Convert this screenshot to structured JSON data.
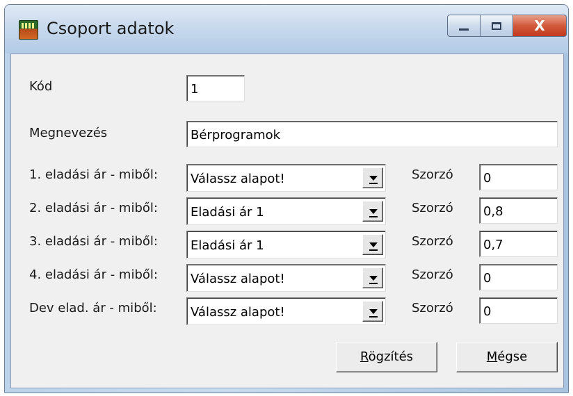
{
  "window": {
    "title": "Csoport adatok",
    "icon": "app-icon",
    "controls": {
      "minimize": "minimize",
      "maximize": "maximize",
      "close": "X"
    }
  },
  "form": {
    "code_label": "Kód",
    "code_value": "1",
    "name_label": "Megnevezés",
    "name_value": "Bérprogramok",
    "multiplier_label": "Szorzó",
    "rows": [
      {
        "label": "1. eladási ár - miből:",
        "source": "Válassz alapot!",
        "multiplier": "0"
      },
      {
        "label": "2. eladási ár - miből:",
        "source": "Eladási ár 1",
        "multiplier": "0,8"
      },
      {
        "label": "3. eladási ár - miből:",
        "source": "Eladási ár 1",
        "multiplier": "0,7"
      },
      {
        "label": "4. eladási ár - miből:",
        "source": "Válassz alapot!",
        "multiplier": "0"
      },
      {
        "label": "Dev elad. ár - miből:",
        "source": "Válassz alapot!",
        "multiplier": "0"
      }
    ]
  },
  "buttons": {
    "save_accel": "R",
    "save_rest": "ögzítés",
    "cancel_accel": "M",
    "cancel_rest": "égse"
  }
}
